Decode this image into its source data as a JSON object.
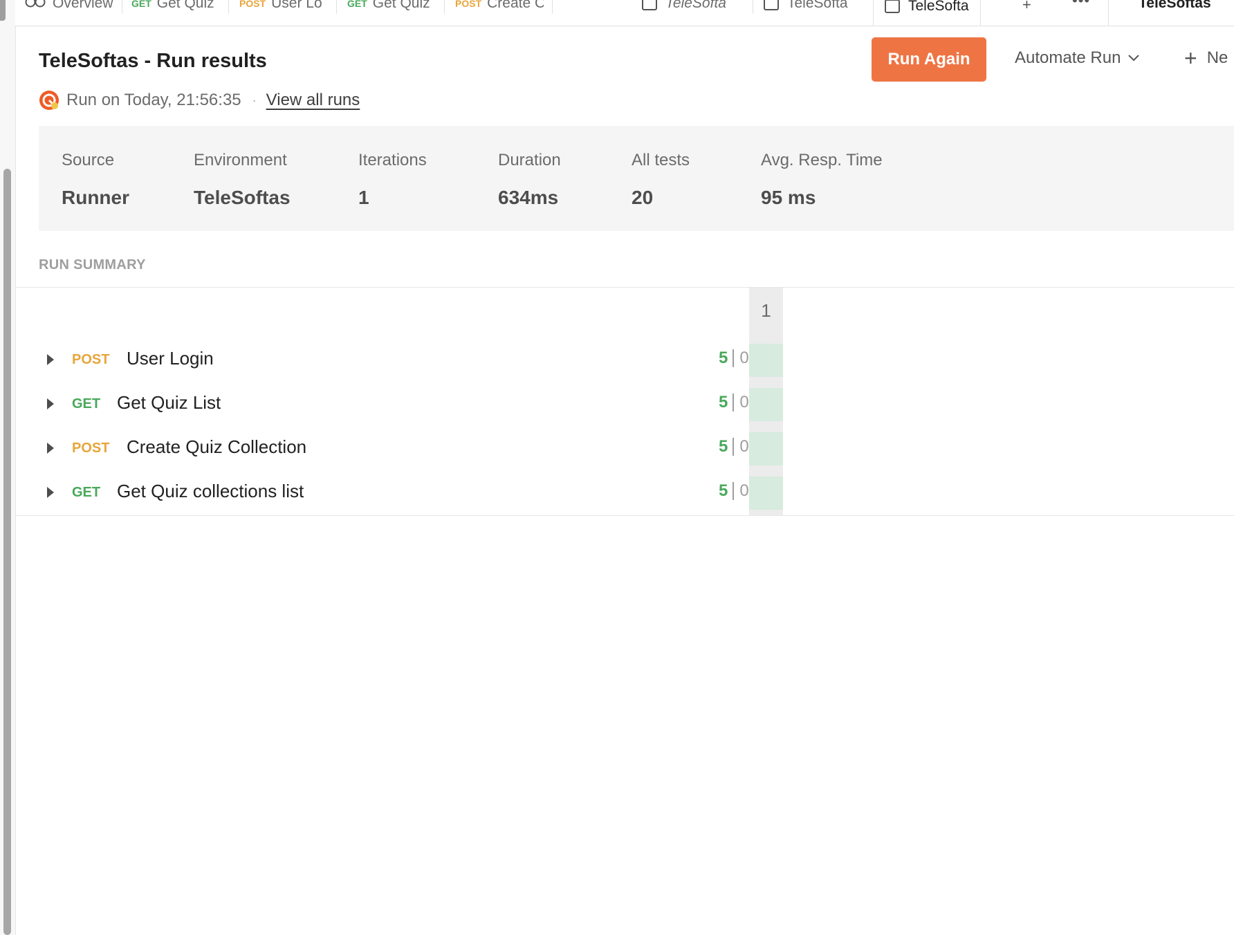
{
  "tabs": [
    {
      "method": "",
      "label": "Overview",
      "icon": "overview-icon"
    },
    {
      "method": "GET",
      "label": "Get Quiz"
    },
    {
      "method": "POST",
      "label": "User Lo"
    },
    {
      "method": "GET",
      "label": "Get Quiz"
    },
    {
      "method": "POST",
      "label": "Create C"
    },
    {
      "method": "",
      "label": "TeleSofta",
      "icon": "collection-icon"
    },
    {
      "method": "",
      "label": "TeleSofta",
      "icon": "runner-icon"
    },
    {
      "method": "",
      "label": "TeleSofta",
      "icon": "runner-icon"
    },
    {
      "method": "",
      "label": "TeleSoftas"
    }
  ],
  "header": {
    "title": "TeleSoftas - Run results",
    "run_on": "Run on Today, 21:56:35",
    "separator": "·",
    "view_all": "View all runs",
    "run_again": "Run Again",
    "automate": "Automate Run",
    "new_label": "Ne"
  },
  "stats": [
    {
      "label": "Source",
      "value": "Runner"
    },
    {
      "label": "Environment",
      "value": "TeleSoftas"
    },
    {
      "label": "Iterations",
      "value": "1"
    },
    {
      "label": "Duration",
      "value": "634ms"
    },
    {
      "label": "All tests",
      "value": "20"
    },
    {
      "label": "Avg. Resp. Time",
      "value": "95 ms"
    }
  ],
  "summary": {
    "heading": "RUN SUMMARY",
    "iteration_header": "1",
    "requests": [
      {
        "method": "POST",
        "name": "User Login",
        "passed": "5",
        "failed": "0"
      },
      {
        "method": "GET",
        "name": "Get Quiz List",
        "passed": "5",
        "failed": "0"
      },
      {
        "method": "POST",
        "name": "Create Quiz Collection",
        "passed": "5",
        "failed": "0"
      },
      {
        "method": "GET",
        "name": "Get Quiz collections list",
        "passed": "5",
        "failed": "0"
      }
    ]
  },
  "colors": {
    "accent": "#ef7444",
    "post": "#e8a53a",
    "get": "#49a85a",
    "pass_cell": "#d7ebdf"
  }
}
